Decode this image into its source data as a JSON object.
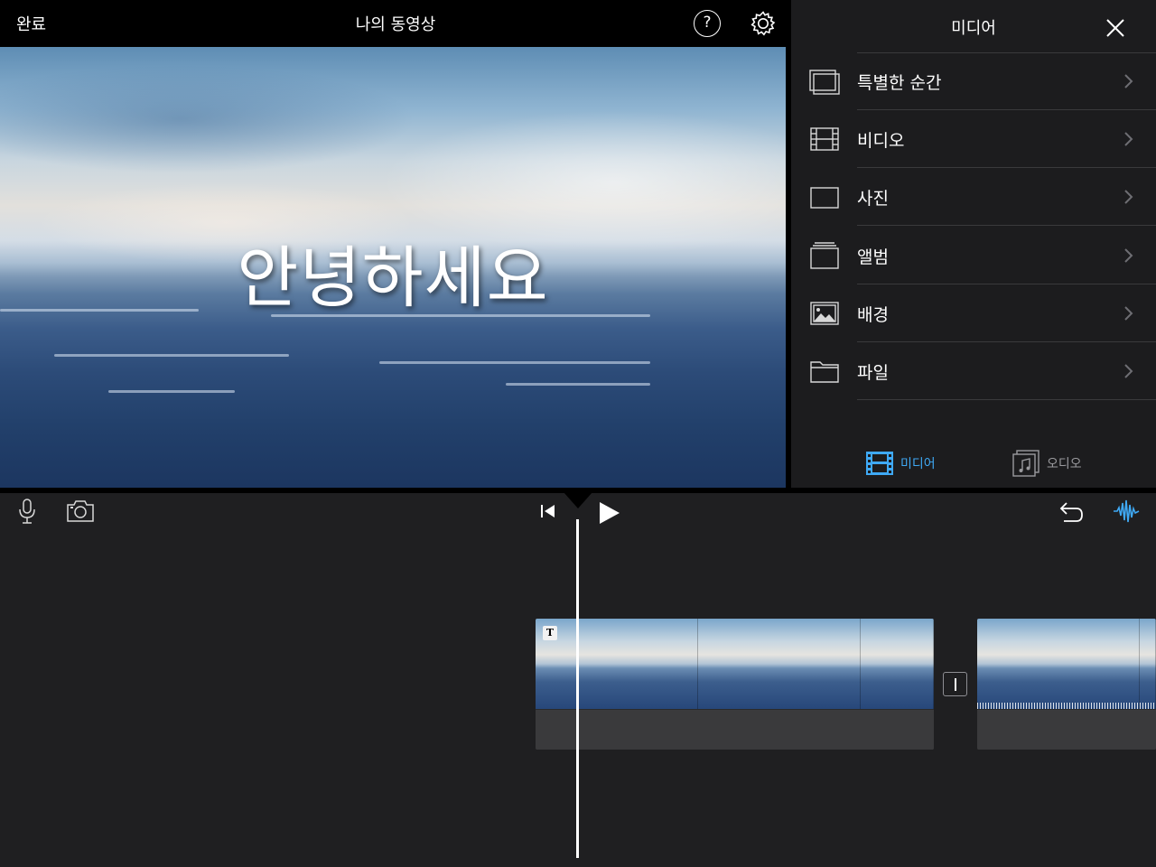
{
  "topbar": {
    "done_label": "완료",
    "project_title": "나의 동영상",
    "help_label": "?"
  },
  "viewer": {
    "title_text": "안녕하세요"
  },
  "media_panel": {
    "title": "미디어",
    "items": [
      {
        "label": "특별한 순간",
        "icon": "moments-icon"
      },
      {
        "label": "비디오",
        "icon": "film-icon"
      },
      {
        "label": "사진",
        "icon": "photo-frame-icon"
      },
      {
        "label": "앨범",
        "icon": "album-stack-icon"
      },
      {
        "label": "배경",
        "icon": "landscape-image-icon"
      },
      {
        "label": "파일",
        "icon": "folder-icon"
      }
    ],
    "tabs": [
      {
        "label": "미디어",
        "active": true,
        "icon": "media-film-icon"
      },
      {
        "label": "오디오",
        "active": false,
        "icon": "music-note-icon"
      }
    ]
  },
  "colors": {
    "accent": "#3fa9f5",
    "background": "#1f1f21",
    "panel": "#1c1c1e"
  },
  "timeline": {
    "clip_title_badge": "T",
    "toolbar_icons": [
      "microphone-icon",
      "camera-icon",
      "skip-to-start-icon",
      "play-icon",
      "undo-icon",
      "audio-waveform-icon"
    ]
  }
}
